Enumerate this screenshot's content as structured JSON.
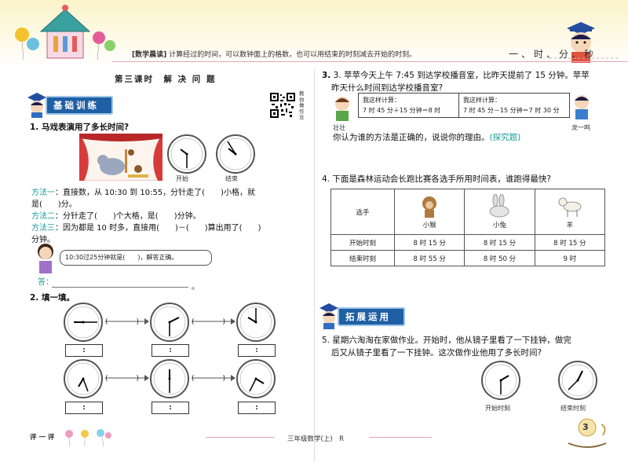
{
  "header": {
    "morning_tag": "[数学晨读]",
    "morning_text": "计算经过的时间，可以数钟面上的格数，也可以用结束的时刻减去开始的时刻。",
    "unit_title": "一、时、分、秒"
  },
  "lesson_title": "第三课时　解 决 问 题",
  "qr_label": "教你做作业",
  "sections": {
    "basic": "基础训练",
    "extend": "拓展运用"
  },
  "q1": {
    "title": "1. 马戏表演用了多长时间?",
    "start_label": "开始",
    "end_label": "结束",
    "m1_tag": "方法一",
    "m1_text": "：直接数，从 10:30 到 10:55，分针走了(　　)小格，就",
    "m1_text2": "是(　　)分。",
    "m2_tag": "方法二",
    "m2_text": "：分针走了(　　)个大格，是(　　)分钟。",
    "m3_tag": "方法三",
    "m3_text": "：因为都是 10 时多，直接用(　　)－(　　)算出用了(　　)",
    "m3_text2": "分钟。",
    "bubble": "10:30过25分钟就是(　　)，解答正确。",
    "answer_label": "答："
  },
  "q2": {
    "title": "2. 填一填。",
    "paren": "(　　　　)",
    "colon": ":"
  },
  "q3": {
    "title": "3. 苹苹今天上午 7:45 到达学校播音室，比昨天提前了 15 分钟。苹苹",
    "title2": "昨天什么时间到达学校播音室?",
    "left_box_1": "我这样计算：",
    "left_box_2": "7 时 45 分＋15 分钟＝8 时",
    "right_box_1": "我这样计算：",
    "right_box_2": "7 时 45 分－15 分钟＝7 时 30 分",
    "left_name": "壮壮",
    "right_name": "龙一鸣",
    "prompt": "你认为谁的方法是正确的，说说你的理由。",
    "prompt_tag": "(探究题)"
  },
  "q4": {
    "title": "4. 下面是森林运动会长跑比赛各选手所用时间表，谁跑得最快?",
    "header_col": "选手",
    "players": [
      "小猴",
      "小兔",
      "羊"
    ],
    "row_start": "开始时刻",
    "row_end": "结束时刻",
    "start": [
      "8 时 15 分",
      "8 时 15 分",
      "8 时 15 分"
    ],
    "end": [
      "8 时 55 分",
      "8 时 50 分",
      "9 时"
    ]
  },
  "q5": {
    "title": "5. 星期六淘淘在家做作业。开始时，他从镜子里看了一下挂钟，做完",
    "title2": "后又从镜子里看了一下挂钟。这次做作业他用了多长时间?",
    "start_label": "开始时刻",
    "end_label": "结束时刻"
  },
  "footer": {
    "rate": "评 一 评",
    "book": "三年级数学(上)　R",
    "page": "3"
  },
  "colors": {
    "teal": "#1a9a9a",
    "badge": "#1f5fa3",
    "pink_rule": "#e6a3c0"
  }
}
